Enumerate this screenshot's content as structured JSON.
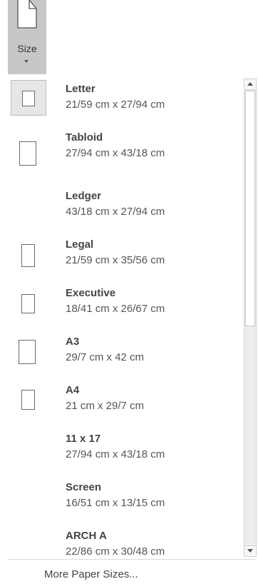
{
  "size_button": {
    "label": "Size",
    "icon": "page-size-icon"
  },
  "paper_sizes": [
    {
      "name": "Letter",
      "dimensions": "21/59 cm x 27/94 cm",
      "selected": true,
      "icon": "portrait-page-icon"
    },
    {
      "name": "Tabloid",
      "dimensions": "27/94 cm x 43/18 cm",
      "selected": false,
      "icon": "portrait-page-icon"
    },
    {
      "name": "Ledger",
      "dimensions": "43/18 cm x 27/94 cm",
      "selected": false,
      "icon": "none"
    },
    {
      "name": "Legal",
      "dimensions": "21/59 cm x 35/56 cm",
      "selected": false,
      "icon": "portrait-page-icon"
    },
    {
      "name": "Executive",
      "dimensions": "18/41 cm x 26/67 cm",
      "selected": false,
      "icon": "portrait-page-icon"
    },
    {
      "name": "A3",
      "dimensions": "29/7 cm x 42 cm",
      "selected": false,
      "icon": "portrait-page-icon"
    },
    {
      "name": "A4",
      "dimensions": "21 cm x 29/7 cm",
      "selected": false,
      "icon": "portrait-page-icon"
    },
    {
      "name": "11 x 17",
      "dimensions": "27/94 cm x 43/18 cm",
      "selected": false,
      "icon": "none"
    },
    {
      "name": "Screen",
      "dimensions": "16/51 cm x 13/15 cm",
      "selected": false,
      "icon": "none"
    },
    {
      "name": "ARCH A",
      "dimensions": "22/86 cm x 30/48 cm",
      "selected": false,
      "icon": "none"
    }
  ],
  "footer": {
    "more_label": "More Paper Sizes..."
  },
  "colors": {
    "button_bg": "#c7c7c7",
    "selected_bg": "#e6e6e6"
  }
}
